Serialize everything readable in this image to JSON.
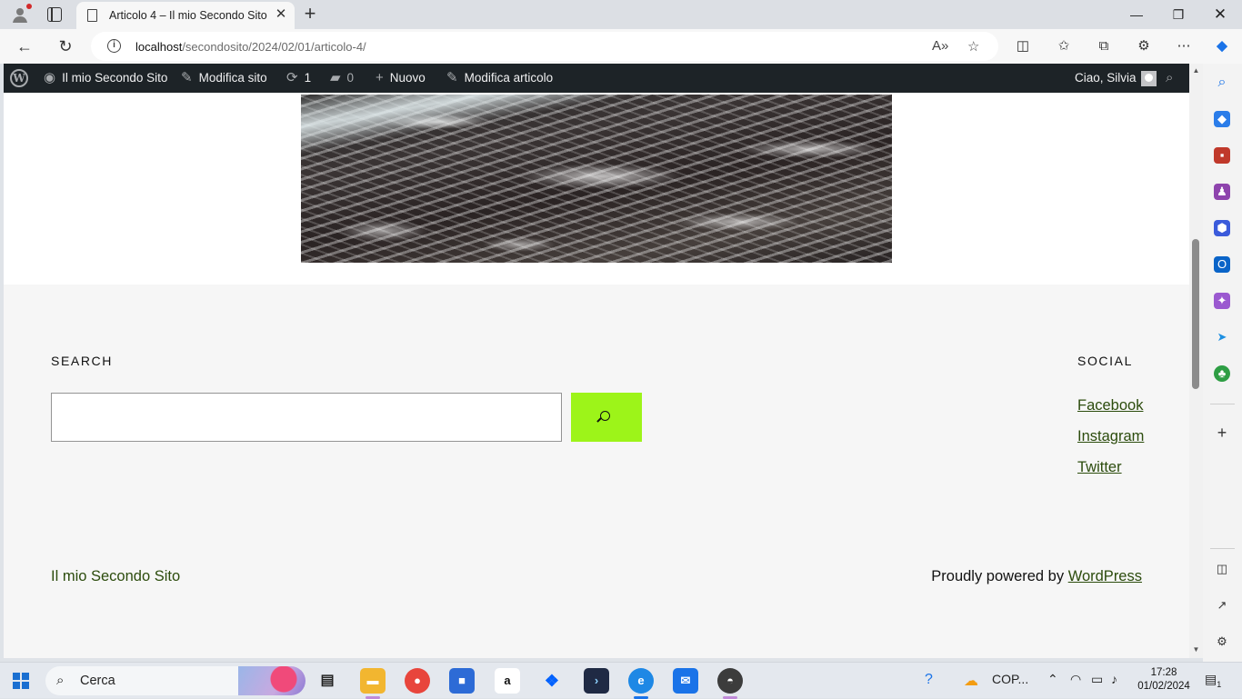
{
  "browser": {
    "tab_title": "Articolo 4 – Il mio Secondo Sito",
    "url_host": "localhost",
    "url_path": "/secondosito/2024/02/01/articolo-4/"
  },
  "adminbar": {
    "site_name": "Il mio Secondo Sito",
    "customize": "Modifica sito",
    "updates_count": "1",
    "comments_count": "0",
    "new": "Nuovo",
    "edit_post": "Modifica articolo",
    "greeting": "Ciao, Silvia"
  },
  "footer": {
    "search_title": "SEARCH",
    "search_value": "",
    "social_title": "SOCIAL",
    "social_links": [
      "Facebook",
      "Instagram",
      "Twitter"
    ],
    "site_title": "Il mio Secondo Sito",
    "powered_prefix": "Proudly powered by ",
    "powered_link": "WordPress"
  },
  "colors": {
    "adminbar_bg": "#1d2327",
    "search_button": "#9df419",
    "link": "#2c4c0d",
    "footer_bg": "#f6f6f6"
  },
  "taskbar": {
    "search_label": "Cerca",
    "tray_app": "COP...",
    "time": "17:28",
    "date": "01/02/2024",
    "notification_count": "1"
  }
}
